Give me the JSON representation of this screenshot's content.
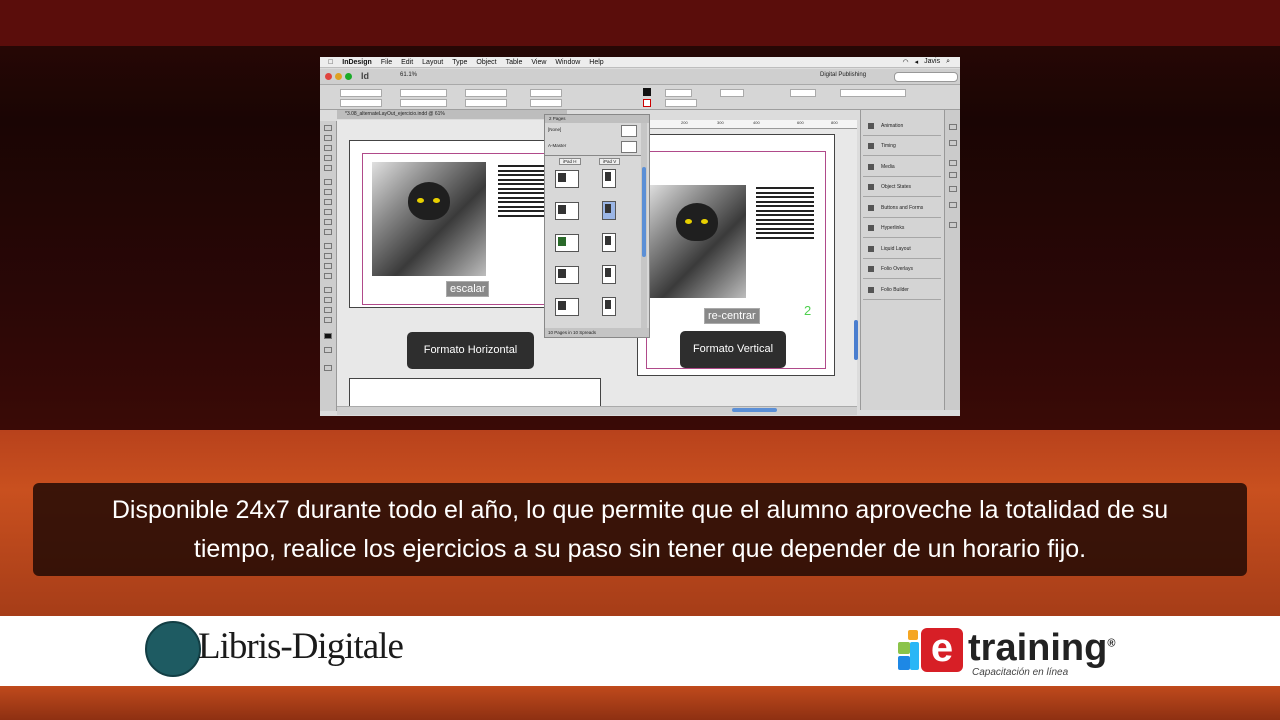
{
  "screenshot": {
    "menu": {
      "app": "InDesign",
      "items": [
        "File",
        "Edit",
        "Layout",
        "Type",
        "Object",
        "Table",
        "View",
        "Window",
        "Help"
      ],
      "user": "Javis"
    },
    "appbar": {
      "logo": "Id",
      "zoom": "61.1%",
      "workspace": "Digital Publishing"
    },
    "document_tab": "*3.08_alternateLayOut_ejercicio.indd @ 61%",
    "pages_panel": {
      "title": "2 Pages",
      "none_label": "[None]",
      "master_label": "A-Master",
      "col_h": "iPad H",
      "col_v": "iPad V",
      "footer": "10 Pages in 10 Spreads"
    },
    "ruler": [
      "200",
      "300",
      "400",
      "600",
      "800"
    ],
    "layout_h": {
      "scale_label": "escalar",
      "format_label": "Formato Horizontal"
    },
    "layout_v": {
      "center_label": "re-centrar",
      "format_label": "Formato Vertical",
      "page_number": "2"
    },
    "right_panel": {
      "items": [
        "Animation",
        "Timing",
        "Media",
        "Object States",
        "Buttons and Forms",
        "Hyperlinks",
        "Liquid Layout",
        "Folio Overlays",
        "Folio Builder"
      ]
    }
  },
  "caption": {
    "line1": "Disponible 24x7 durante todo el año, lo que permite que el alumno aproveche la totalidad de su",
    "line2": "tiempo, realice los ejercicios a su paso sin tener que depender de un horario fijo."
  },
  "footer": {
    "libris": "Libris-Digitale",
    "etraining": "training",
    "etraining_mark": "®",
    "etraining_letter": "e",
    "etraining_sub": "Capacitación en línea"
  },
  "colors": {
    "accent_red": "#d71f26",
    "libris_teal": "#1e5b62"
  }
}
